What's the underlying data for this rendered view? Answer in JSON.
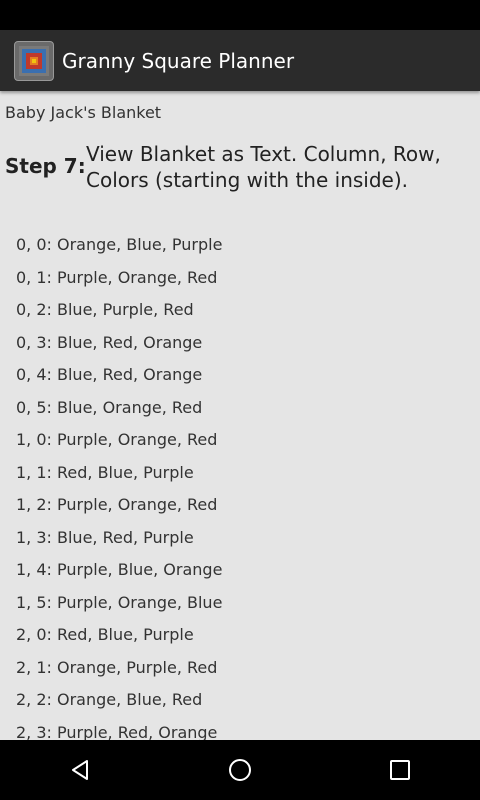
{
  "app": {
    "title": "Granny Square Planner",
    "icon": "granny-square-app-icon"
  },
  "blanket": {
    "name": "Baby Jack's Blanket"
  },
  "step": {
    "label": "Step 7:",
    "description": "View Blanket as Text. Column, Row, Colors (starting with the inside)."
  },
  "entries": [
    "0, 0: Orange, Blue, Purple",
    "0, 1: Purple, Orange, Red",
    "0, 2: Blue, Purple, Red",
    "0, 3: Blue, Red, Orange",
    "0, 4: Blue, Red, Orange",
    "0, 5: Blue, Orange, Red",
    "1, 0: Purple, Orange, Red",
    "1, 1: Red, Blue, Purple",
    "1, 2: Purple, Orange, Red",
    "1, 3: Blue, Red, Purple",
    "1, 4: Purple, Blue, Orange",
    "1, 5: Purple, Orange, Blue",
    "2, 0: Red, Blue, Purple",
    "2, 1: Orange, Purple, Red",
    "2, 2: Orange, Blue, Red",
    "2, 3: Purple, Red, Orange"
  ],
  "nav": {
    "back_icon": "back-icon",
    "home_icon": "home-icon",
    "recents_icon": "recents-icon"
  },
  "colors": {
    "action_bar": "#2b2b2b",
    "background": "#e5e5e5",
    "status_bar": "#000000"
  }
}
